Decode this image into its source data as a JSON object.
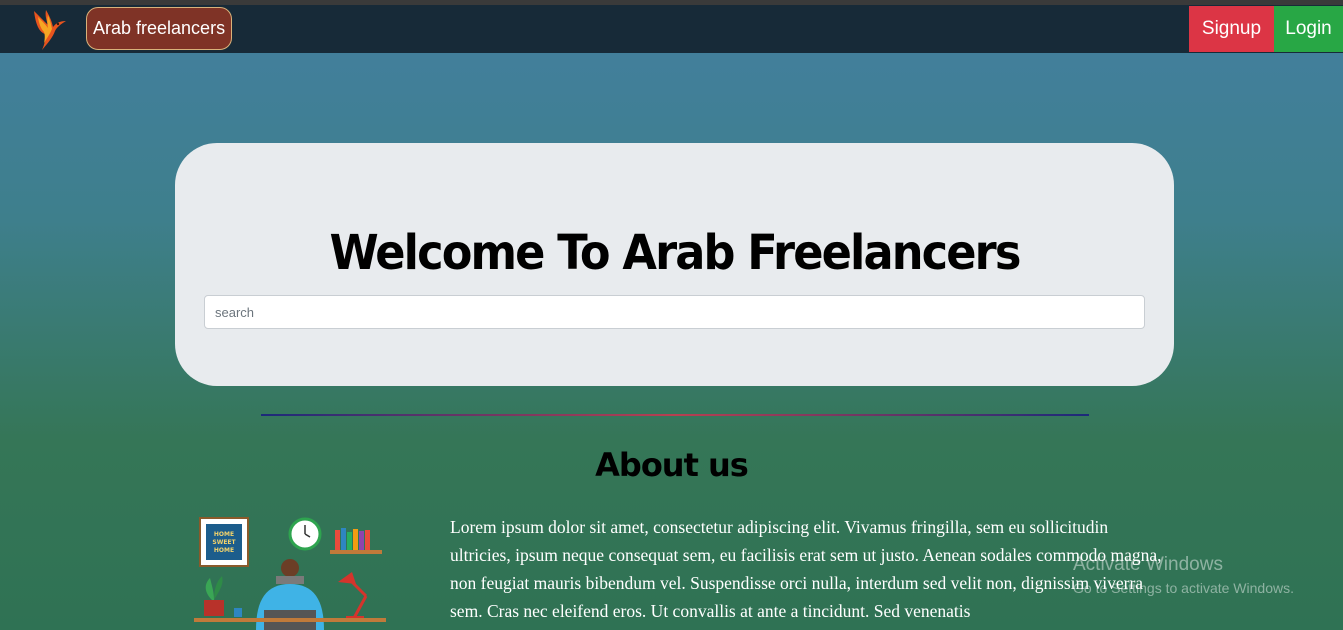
{
  "navbar": {
    "logo_icon": "phoenix-bird-icon",
    "brand_label": "Arab freelancers",
    "signup_label": "Signup",
    "login_label": "Login"
  },
  "hero": {
    "title": "Welcome To Arab Freelancers",
    "search_placeholder": "search"
  },
  "about": {
    "title": "About us",
    "illustration_icon": "person-working-at-desk-icon",
    "illustration_frame_text": "HOME SWEET HOME",
    "text": "Lorem ipsum dolor sit amet, consectetur adipiscing elit. Vivamus fringilla, sem eu sollicitudin ultricies, ipsum neque consequat sem, eu facilisis erat sem ut justo. Aenean sodales commodo magna, non feugiat mauris bibendum vel. Suspendisse orci nulla, interdum sed velit non, dignissim viverra sem. Cras nec eleifend eros. Ut convallis at ante a tincidunt. Sed venenatis"
  },
  "os_overlay": {
    "title": "Activate Windows",
    "subtitle": "Go to Settings to activate Windows."
  },
  "colors": {
    "navbar_bg": "#172a38",
    "brand_bg": "#7f3326",
    "signup_bg": "#dc3545",
    "login_bg": "#28a745",
    "hero_bg": "#e8ebee"
  }
}
